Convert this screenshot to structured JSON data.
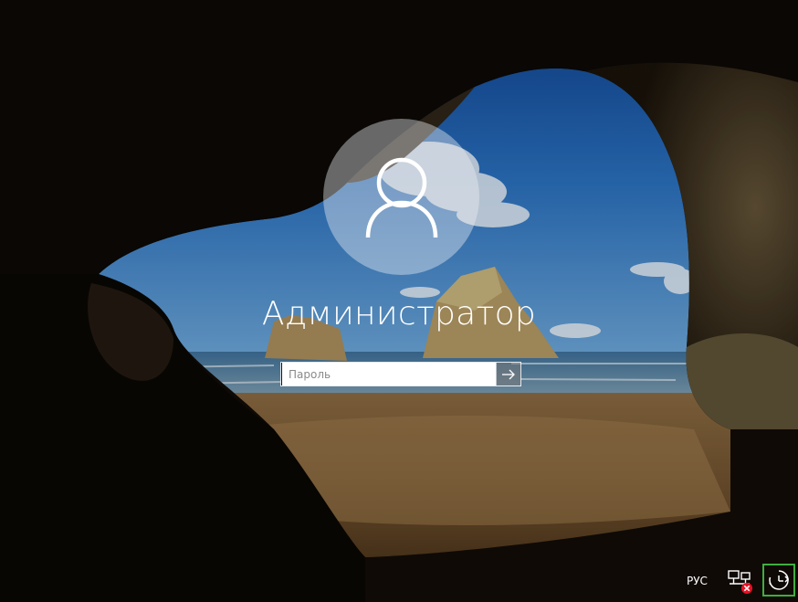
{
  "login": {
    "username": "Администратор",
    "password_placeholder": "Пароль"
  },
  "icons": {
    "avatar": "user-silhouette-icon",
    "submit": "arrow-right-icon",
    "network": "network-disconnected-icon",
    "ease_of_access": "ease-of-access-icon"
  },
  "system_tray": {
    "language": "РУС"
  },
  "colors": {
    "focus_highlight": "#3fae3f",
    "network_error": "#e81123"
  }
}
